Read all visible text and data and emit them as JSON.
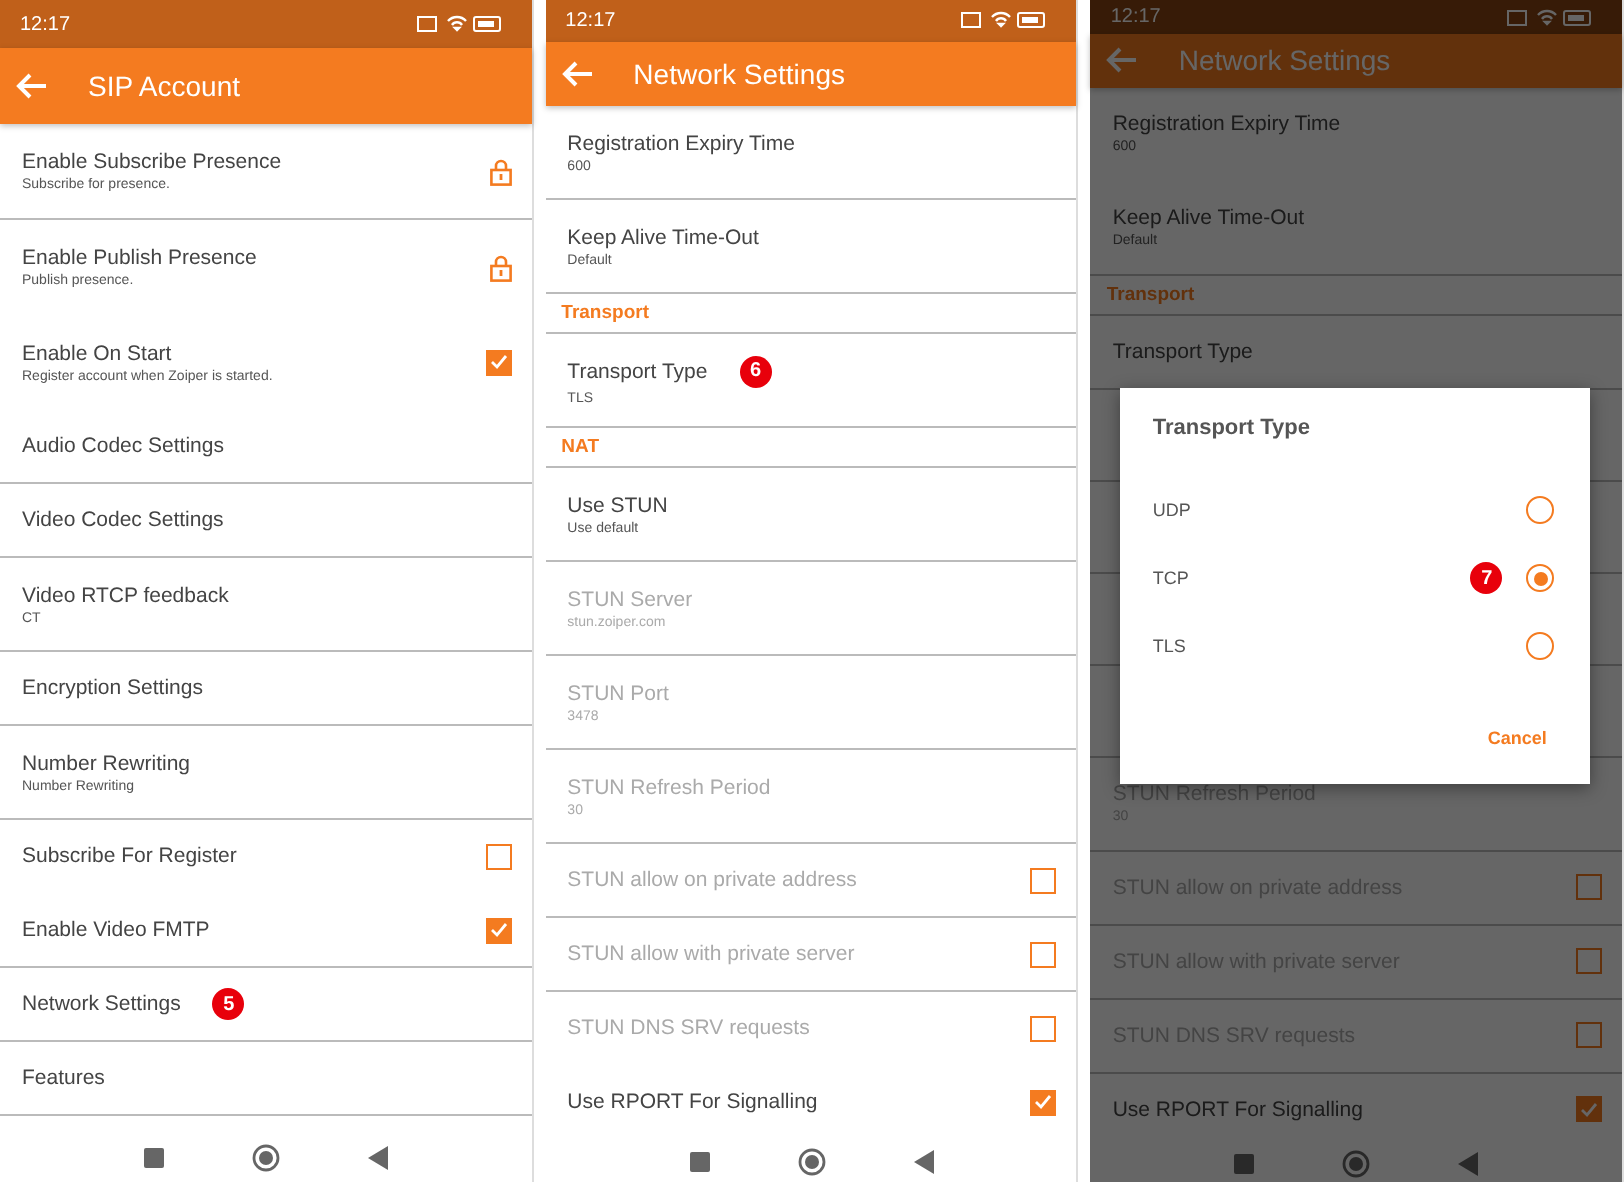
{
  "screens": [
    {
      "time": "12:17",
      "title": "SIP Account",
      "dimmed": false,
      "items": [
        {
          "kind": "lock",
          "label": "Enable Subscribe Presence",
          "subtitle": "Subscribe for presence.",
          "divider": true
        },
        {
          "kind": "lock",
          "label": "Enable Publish Presence",
          "subtitle": "Publish presence.",
          "divider": false
        },
        {
          "kind": "checkbox",
          "label": "Enable On Start",
          "subtitle": "Register account when Zoiper is started.",
          "checked": true,
          "divider": false
        },
        {
          "kind": "plain",
          "label": "Audio Codec Settings",
          "divider": true
        },
        {
          "kind": "plain",
          "label": "Video Codec Settings",
          "divider": true
        },
        {
          "kind": "plain",
          "label": "Video RTCP feedback",
          "subtitle": "CT",
          "divider": true
        },
        {
          "kind": "plain",
          "label": "Encryption Settings",
          "divider": true
        },
        {
          "kind": "plain",
          "label": "Number Rewriting",
          "subtitle": "Number Rewriting",
          "divider": true
        },
        {
          "kind": "checkbox",
          "label": "Subscribe For Register",
          "checked": false,
          "divider": false
        },
        {
          "kind": "checkbox",
          "label": "Enable Video FMTP",
          "checked": true,
          "divider": true
        },
        {
          "kind": "plain",
          "label": "Network Settings",
          "badge": "5",
          "divider": true
        },
        {
          "kind": "plain",
          "label": "Features",
          "divider": true
        }
      ]
    },
    {
      "time": "12:17",
      "title": "Network Settings",
      "dimmed": false,
      "items": [
        {
          "kind": "plain",
          "label": "Registration Expiry Time",
          "subtitle": "600",
          "divider": true
        },
        {
          "kind": "plain",
          "label": "Keep Alive Time-Out",
          "subtitle": "Default",
          "divider": true
        },
        {
          "kind": "header",
          "label": "Transport",
          "divider": true
        },
        {
          "kind": "plain",
          "label": "Transport Type",
          "subtitle": "TLS",
          "badge": "6",
          "divider": true
        },
        {
          "kind": "header",
          "label": "NAT",
          "divider": true
        },
        {
          "kind": "plain",
          "label": "Use STUN",
          "subtitle": "Use default",
          "divider": true
        },
        {
          "kind": "plain",
          "label": "STUN Server",
          "subtitle": "stun.zoiper.com",
          "disabled": true,
          "divider": true
        },
        {
          "kind": "plain",
          "label": "STUN Port",
          "subtitle": "3478",
          "disabled": true,
          "divider": true
        },
        {
          "kind": "plain",
          "label": "STUN Refresh Period",
          "subtitle": "30",
          "disabled": true,
          "divider": true
        },
        {
          "kind": "checkbox",
          "label": "STUN allow on private address",
          "checked": false,
          "disabled": true,
          "divider": true
        },
        {
          "kind": "checkbox",
          "label": "STUN allow with private server",
          "checked": false,
          "disabled": true,
          "divider": true
        },
        {
          "kind": "checkbox",
          "label": "STUN DNS SRV requests",
          "checked": false,
          "disabled": true,
          "divider": false
        },
        {
          "kind": "checkbox",
          "label": "Use RPORT For Signalling",
          "checked": true,
          "divider": false
        }
      ]
    },
    {
      "time": "12:17",
      "title": "Network Settings",
      "dimmed": true,
      "items": [
        {
          "kind": "plain",
          "label": "Registration Expiry Time",
          "subtitle": "600",
          "divider": false
        },
        {
          "kind": "plain",
          "label": "Keep Alive Time-Out",
          "subtitle": "Default",
          "divider": true
        },
        {
          "kind": "header",
          "label": "Transport",
          "divider": true
        },
        {
          "kind": "plain",
          "label": "Transport Type",
          "divider": true
        },
        {
          "kind": "covered",
          "divider": true
        },
        {
          "kind": "covered",
          "divider": true
        },
        {
          "kind": "covered",
          "divider": true
        },
        {
          "kind": "covered",
          "divider": true
        },
        {
          "kind": "plain",
          "label": "STUN Refresh Period",
          "subtitle": "30",
          "disabled": true,
          "divider": true
        },
        {
          "kind": "checkbox",
          "label": "STUN allow on private address",
          "checked": false,
          "disabled": true,
          "divider": true
        },
        {
          "kind": "checkbox",
          "label": "STUN allow with private server",
          "checked": false,
          "disabled": true,
          "divider": true
        },
        {
          "kind": "checkbox",
          "label": "STUN DNS SRV requests",
          "checked": false,
          "disabled": true,
          "divider": true
        },
        {
          "kind": "checkbox",
          "label": "Use RPORT For Signalling",
          "checked": true,
          "divider": false
        }
      ],
      "dialog": {
        "title": "Transport Type",
        "options": [
          {
            "label": "UDP",
            "selected": false
          },
          {
            "label": "TCP",
            "selected": true,
            "badge": "7"
          },
          {
            "label": "TLS",
            "selected": false
          }
        ],
        "button": "Cancel"
      }
    }
  ]
}
